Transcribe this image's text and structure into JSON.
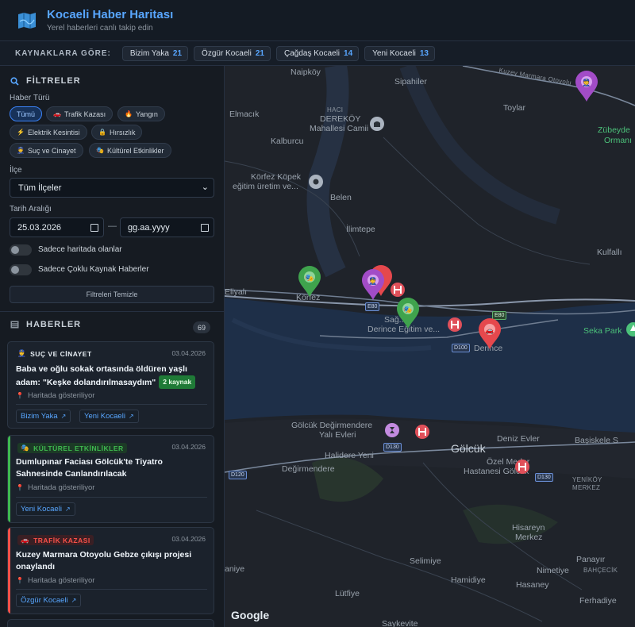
{
  "header": {
    "title": "Kocaeli Haber Haritası",
    "subtitle": "Yerel haberleri canlı takip edin",
    "logo_icon": "folded-map-icon"
  },
  "sources": {
    "label": "KAYNAKLARA GÖRE:",
    "items": [
      {
        "name": "Bizim Yaka",
        "count": "21"
      },
      {
        "name": "Özgür Kocaeli",
        "count": "21"
      },
      {
        "name": "Çağdaş Kocaeli",
        "count": "14"
      },
      {
        "name": "Yeni Kocaeli",
        "count": "13"
      }
    ]
  },
  "filters": {
    "title": "FİLTRELER",
    "type_label": "Haber Türü",
    "types": [
      {
        "label": "Tümü",
        "active": true
      },
      {
        "label": "Trafik Kazası",
        "icon": "car-icon"
      },
      {
        "label": "Yangın",
        "icon": "fire-icon"
      },
      {
        "label": "Elektrik Kesintisi",
        "icon": "lightning-icon"
      },
      {
        "label": "Hırsızlık",
        "icon": "lock-icon"
      },
      {
        "label": "Suç ve Cinayet",
        "icon": "police-icon"
      },
      {
        "label": "Kültürel Etkinlikler",
        "icon": "theater-icon"
      }
    ],
    "district_label": "İlçe",
    "district_value": "Tüm İlçeler",
    "date_label": "Tarih Aralığı",
    "date_from": "25.03.2026",
    "date_to": "gg.aa.yyyy",
    "date_sep": "—",
    "toggle_map": "Sadece haritada olanlar",
    "toggle_multi": "Sadece Çoklu Kaynak Haberler",
    "clear": "Filtreleri Temizle"
  },
  "news": {
    "title": "HABERLER",
    "count": "69",
    "items": [
      {
        "category": "SUÇ VE CİNAYET",
        "date": "03.04.2026",
        "title": "Baba ve oğlu sokak ortasında öldüren yaşlı adam: \"Keşke dolandırılmasaydım\"",
        "badge": "2 kaynak",
        "location": "Haritada gösteriliyor",
        "links": [
          "Bizim Yaka",
          "Yeni Kocaeli"
        ],
        "color": "#d29922"
      },
      {
        "category": "KÜLTÜREL ETKİNLİKLER",
        "date": "03.04.2026",
        "title": "Dumlupınar Faciası Gölcük'te Tiyatro Sahnesinde Canlandırılacak",
        "location": "Haritada gösteriliyor",
        "links": [
          "Yeni Kocaeli"
        ],
        "color": "#3fb950"
      },
      {
        "category": "TRAFİK KAZASI",
        "date": "03.04.2026",
        "title": "Kuzey Marmara Otoyolu Gebze çıkışı projesi onaylandı",
        "location": "Haritada gösteriliyor",
        "links": [
          "Özgür Kocaeli"
        ],
        "color": "#f85149"
      }
    ]
  },
  "map": {
    "attribution": "Google",
    "labels": {
      "naipkoy": "Naipköy",
      "sipahiler": "Sipahiler",
      "kuzey": "Kuzey Marmara Otoyolu",
      "toylar": "Toylar",
      "elmacik": "Elmacık",
      "haci": "HACI",
      "derekoy": "DEREKÖY",
      "mahallesi": "Mahallesi Camii",
      "zubeyde1": "Zübeyde",
      "zubeyde2": "Ormanı",
      "kalburcu": "Kalburcu",
      "korfez1": "Körfez Köpek",
      "korfez2": "eğitim üretim ve...",
      "belen": "Belen",
      "ilimtepe": "İlimtepe",
      "kulfalli": "Kulfallı",
      "eliyali": "Eliyalı",
      "korfez": "Körfez",
      "sag": "Sağ...",
      "derince_egitim": "Derince Eğitim ve...",
      "derince": "Derince",
      "seka": "Seka Park",
      "golcuk_deg1": "Gölcük Değirmendere",
      "golcuk_deg2": "Yalı Evleri",
      "deniz": "Deniz Evler",
      "basiskele": "Başiskele S",
      "halidere": "Halidere Yeni",
      "golcuk": "Gölcük",
      "degirmendere": "Değirmendere",
      "ozel1": "Özel Medar",
      "ozel2": "Hastanesi Gölcük",
      "yenikoy1": "YENİKÖY",
      "yenikoy2": "MERKEZ",
      "hisareyn1": "Hisareyn",
      "hisareyn2": "Merkez",
      "aniye": "aniye",
      "selimiye": "Selimiye",
      "nimetiye": "Nimetiye",
      "panayir": "Panayır",
      "bahcecik": "BAHÇECİK",
      "hamidiye": "Hamidiye",
      "hasaney": "Hasaney",
      "lutfiye": "Lütfiye",
      "ferhadiye": "Ferhadiye",
      "saykevite": "Saykevite"
    },
    "shields": {
      "e80": "E80",
      "e80b": "E80",
      "d100": "D100",
      "d130a": "D130",
      "d130b": "D130",
      "d120": "D120"
    }
  }
}
